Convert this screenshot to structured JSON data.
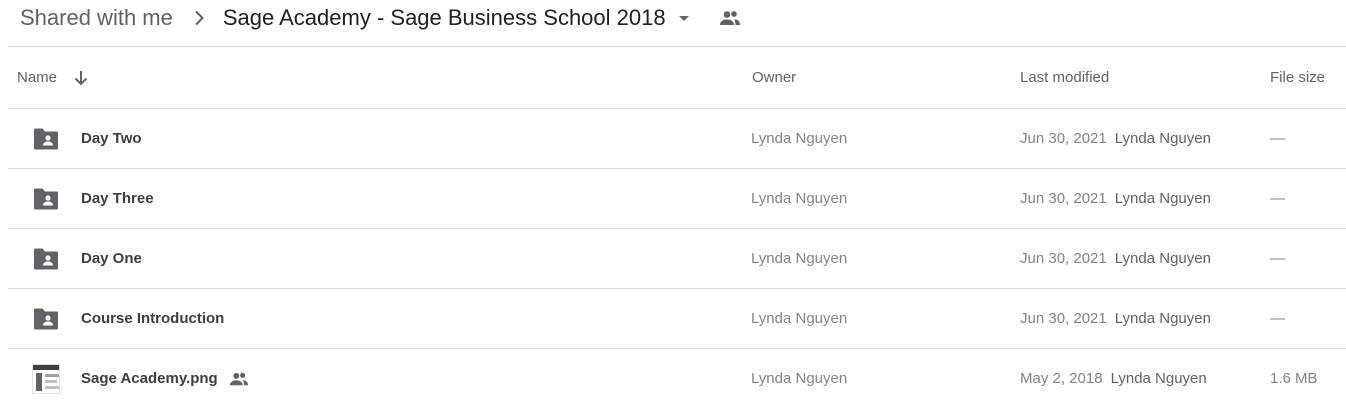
{
  "breadcrumb": {
    "root": "Shared with me",
    "current": "Sage Academy - Sage Business School 2018"
  },
  "columns": {
    "name": "Name",
    "owner": "Owner",
    "last_modified": "Last modified",
    "file_size": "File size"
  },
  "rows": [
    {
      "name": "Day Two",
      "owner": "Lynda Nguyen",
      "date": "Jun 30, 2021",
      "modified_by": "Lynda Nguyen",
      "size": "—",
      "type": "shared-folder-icon"
    },
    {
      "name": "Day Three",
      "owner": "Lynda Nguyen",
      "date": "Jun 30, 2021",
      "modified_by": "Lynda Nguyen",
      "size": "—",
      "type": "shared-folder-icon"
    },
    {
      "name": "Day One",
      "owner": "Lynda Nguyen",
      "date": "Jun 30, 2021",
      "modified_by": "Lynda Nguyen",
      "size": "—",
      "type": "shared-folder-icon"
    },
    {
      "name": "Course Introduction",
      "owner": "Lynda Nguyen",
      "date": "Jun 30, 2021",
      "modified_by": "Lynda Nguyen",
      "size": "—",
      "type": "shared-folder-icon"
    },
    {
      "name": "Sage Academy.png",
      "owner": "Lynda Nguyen",
      "date": "May 2, 2018",
      "modified_by": "Lynda Nguyen",
      "size": "1.6 MB",
      "type": "image-thumbnail",
      "shared": true
    }
  ],
  "colors": {
    "icon": "#5f6368",
    "divider": "#dadce0",
    "muted_text": "#80868b"
  }
}
